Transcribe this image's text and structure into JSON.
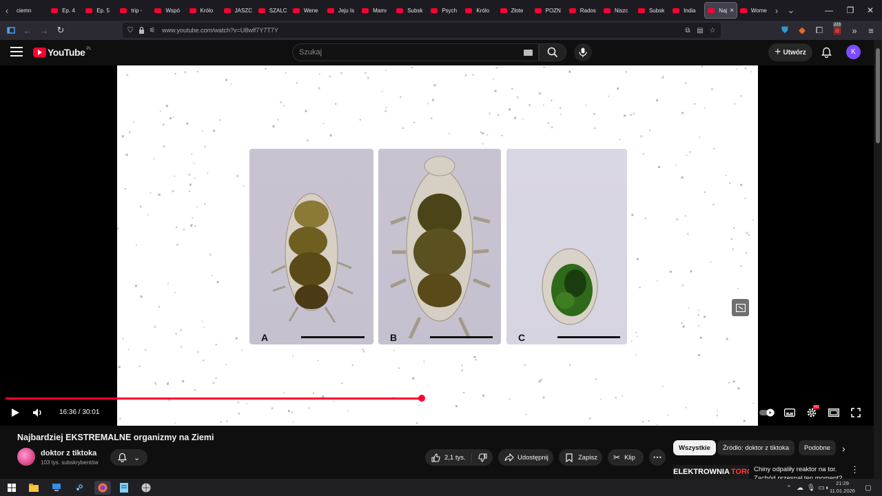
{
  "browser": {
    "tabs": [
      {
        "label": "ciemn",
        "favicon": false
      },
      {
        "label": "Ep. 4"
      },
      {
        "label": "Ep. 5"
      },
      {
        "label": "trip -"
      },
      {
        "label": "Wspó"
      },
      {
        "label": "Królo"
      },
      {
        "label": "JASZC"
      },
      {
        "label": "SZALC"
      },
      {
        "label": "Wene"
      },
      {
        "label": "Jeju Is"
      },
      {
        "label": "Mamı"
      },
      {
        "label": "Subsk"
      },
      {
        "label": "Psych"
      },
      {
        "label": "Królo"
      },
      {
        "label": "Złote"
      },
      {
        "label": "POZN"
      },
      {
        "label": "Rados"
      },
      {
        "label": "Niszc"
      },
      {
        "label": "Subsk"
      },
      {
        "label": "India"
      },
      {
        "label": "Naj",
        "active": true
      },
      {
        "label": "Wome"
      }
    ],
    "url": "www.youtube.com/watch?v=U8wlf7Y7T7Y",
    "extension_badge": "223"
  },
  "youtube": {
    "logo_text": "YouTube",
    "region": "PL",
    "search_placeholder": "Szukaj",
    "create_label": "Utwórz",
    "avatar_letter": "K",
    "accent": "#ff0033"
  },
  "player": {
    "panels": [
      "A",
      "B",
      "C"
    ],
    "current_time": "16:36",
    "duration": "30:01",
    "time_display": "16:36 / 30:01",
    "progress_fraction": 0.553,
    "settings_badge": "HD"
  },
  "video": {
    "title": "Najbardziej EKSTREMALNE organizmy na Ziemi",
    "channel_name": "doktor z tiktoka",
    "subscribers": "103 tys. subskrybentów",
    "likes": "2,1 tys.",
    "share_label": "Udostępnij",
    "save_label": "Zapisz",
    "clip_label": "Klip"
  },
  "recommendations": {
    "chips": [
      "Wszystkie",
      "Źródło: doktor z tiktoka",
      "Podobne"
    ],
    "first": {
      "thumb_text_1": "ELEKTROWNIA",
      "thumb_text_2": "TOROWA?",
      "title": "Chiny odpaliły reaktor na tor. Zachód przespał ten moment?"
    }
  },
  "taskbar": {
    "time": "21:29",
    "date": "11.01.2026"
  }
}
